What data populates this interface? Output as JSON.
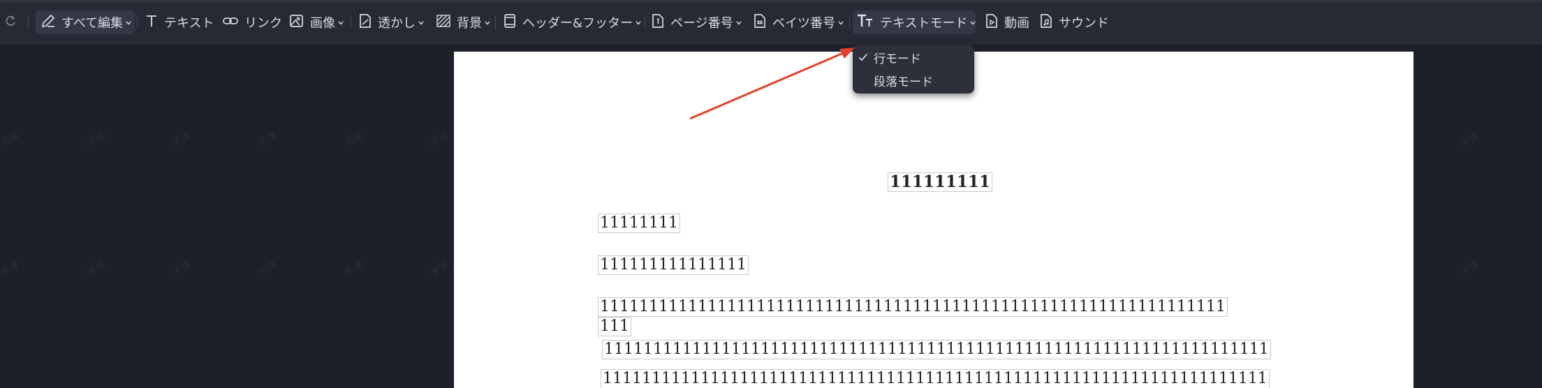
{
  "toolbar": {
    "edit_all_label": "すべて編集",
    "text_label": "テキスト",
    "link_label": "リンク",
    "image_label": "画像",
    "watermark_label": "透かし",
    "background_label": "背景",
    "header_footer_label": "ヘッダー&フッター",
    "page_number_label": "ページ番号",
    "bates_number_label": "ベイツ番号",
    "text_mode_label": "テキストモード",
    "video_label": "動画",
    "sound_label": "サウンド"
  },
  "text_mode_menu": {
    "items": [
      {
        "label": "行モード",
        "checked": true
      },
      {
        "label": "段落モード",
        "checked": false
      }
    ]
  },
  "document": {
    "lines": [
      "111111111",
      "11111111",
      "111111111111111",
      "1111111111111111111111111111111111111111111111111111111111111111",
      "111",
      "11111111111111111111111111111111111111111111111111111111111111111111",
      "11111111111111111111111111111111111111111111111111111111111111111111"
    ]
  },
  "watermark": {
    "text": "子洋"
  },
  "colors": {
    "toolbar_bg": "#272a35",
    "canvas_bg": "#1e2029",
    "menu_bg": "#2d303b",
    "annotation_arrow": "#e0412c"
  },
  "icons": {
    "redo": "redo-icon",
    "edit_all": "pen-edit-icon",
    "text": "text-t-icon",
    "link": "link-icon",
    "image": "image-icon",
    "watermark": "watermark-icon",
    "background": "background-hatch-icon",
    "header_footer": "header-footer-icon",
    "page_number": "page-number-icon",
    "bates_number": "bates-number-icon",
    "text_mode": "text-size-icon",
    "video": "video-file-icon",
    "sound": "sound-file-icon",
    "check": "check-icon"
  }
}
